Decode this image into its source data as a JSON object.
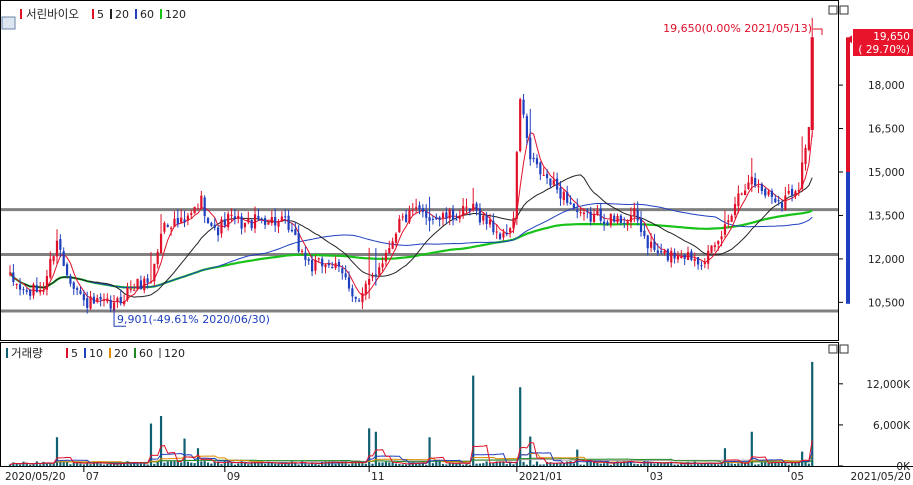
{
  "price_panel": {
    "title": "서린바이오",
    "legend": [
      {
        "label": "5",
        "color": "#e0102a"
      },
      {
        "label": "20",
        "color": "#222222"
      },
      {
        "label": "60",
        "color": "#1f3fbf"
      },
      {
        "label": "120",
        "color": "#19c219"
      }
    ],
    "current_price_label": "19,650",
    "current_change_label": "( 29.70%)",
    "high_annotation": "19,650(0.00% 2021/05/13)",
    "low_annotation": "9,901(-49.61% 2020/06/30)"
  },
  "volume_panel": {
    "title": "거래량",
    "legend": [
      {
        "label": "5",
        "color": "#e0102a"
      },
      {
        "label": "10",
        "color": "#1f3fbf"
      },
      {
        "label": "20",
        "color": "#e08a00"
      },
      {
        "label": "60",
        "color": "#208a20"
      },
      {
        "label": "120",
        "color": "#9a9a9a"
      }
    ]
  },
  "colors": {
    "up": "#e0102a",
    "down": "#1f3fbf",
    "ma5": "#e0102a",
    "ma20": "#222222",
    "ma60": "#1f3fbf",
    "ma120": "#19c219",
    "volume_bar": "#0f6070",
    "hline": "#808080"
  },
  "chart_data": {
    "type": "candlestick",
    "price_axis": {
      "ticks": [
        10500,
        12000,
        13500,
        15000,
        16500,
        18000
      ],
      "tick_labels": [
        "10,500",
        "12,000",
        "13,500",
        "15,000",
        "16,500",
        "18,000"
      ],
      "range": [
        9200,
        20800
      ]
    },
    "volume_axis": {
      "ticks": [
        0,
        6000,
        12000
      ],
      "tick_labels": [
        "0K",
        "6,000K",
        "12,000K"
      ],
      "range": [
        0,
        16500
      ]
    },
    "x_axis": {
      "start_label": "2020/05/20",
      "end_label": "2021/05/20",
      "month_labels": [
        {
          "label": "07",
          "index": 22
        },
        {
          "label": "09",
          "index": 64
        },
        {
          "label": "11",
          "index": 107
        },
        {
          "label": "2021/01",
          "index": 151
        },
        {
          "label": "03",
          "index": 190
        },
        {
          "label": "05",
          "index": 232
        }
      ],
      "count": 245
    },
    "horizontal_lines": [
      13700,
      12150,
      10200
    ],
    "price_anchors": [
      [
        0,
        11300
      ],
      [
        5,
        10800
      ],
      [
        10,
        11000
      ],
      [
        14,
        12700
      ],
      [
        16,
        11800
      ],
      [
        22,
        10500
      ],
      [
        29,
        10400
      ],
      [
        31,
        10350
      ],
      [
        36,
        11000
      ],
      [
        42,
        11300
      ],
      [
        46,
        13300
      ],
      [
        52,
        13200
      ],
      [
        57,
        14000
      ],
      [
        61,
        12900
      ],
      [
        65,
        13400
      ],
      [
        70,
        13200
      ],
      [
        76,
        13400
      ],
      [
        82,
        13200
      ],
      [
        86,
        12400
      ],
      [
        90,
        11700
      ],
      [
        95,
        11900
      ],
      [
        100,
        11300
      ],
      [
        104,
        10500
      ],
      [
        108,
        11400
      ],
      [
        112,
        12200
      ],
      [
        116,
        13300
      ],
      [
        121,
        13600
      ],
      [
        128,
        13400
      ],
      [
        133,
        13500
      ],
      [
        138,
        13700
      ],
      [
        143,
        13200
      ],
      [
        147,
        12700
      ],
      [
        150,
        13400
      ],
      [
        152,
        17600
      ],
      [
        155,
        15400
      ],
      [
        160,
        14700
      ],
      [
        166,
        14100
      ],
      [
        170,
        13400
      ],
      [
        176,
        13500
      ],
      [
        180,
        13300
      ],
      [
        186,
        13500
      ],
      [
        190,
        12500
      ],
      [
        194,
        12100
      ],
      [
        200,
        12200
      ],
      [
        206,
        12000
      ],
      [
        210,
        12300
      ],
      [
        213,
        13100
      ],
      [
        216,
        14000
      ],
      [
        220,
        14800
      ],
      [
        225,
        14300
      ],
      [
        230,
        14000
      ],
      [
        235,
        14600
      ],
      [
        238,
        16600
      ],
      [
        239,
        19650
      ]
    ],
    "volume_spikes": [
      {
        "i": 14,
        "v": 4200
      },
      {
        "i": 42,
        "v": 6200
      },
      {
        "i": 45,
        "v": 7300
      },
      {
        "i": 52,
        "v": 4000
      },
      {
        "i": 56,
        "v": 2600
      },
      {
        "i": 107,
        "v": 5500
      },
      {
        "i": 109,
        "v": 5000
      },
      {
        "i": 125,
        "v": 4200
      },
      {
        "i": 138,
        "v": 13200
      },
      {
        "i": 152,
        "v": 11500
      },
      {
        "i": 155,
        "v": 4300
      },
      {
        "i": 169,
        "v": 2400
      },
      {
        "i": 213,
        "v": 2600
      },
      {
        "i": 221,
        "v": 5000
      },
      {
        "i": 236,
        "v": 2100
      },
      {
        "i": 239,
        "v": 15200
      }
    ],
    "base_volume": 350
  }
}
